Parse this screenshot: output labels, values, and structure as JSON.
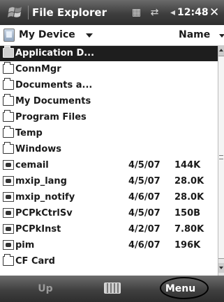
{
  "title_bar": {
    "app_title": "File Explorer",
    "clock": "12:48",
    "close": "✕",
    "status_icons": [
      "sync-icon",
      "connectivity-icon",
      "speaker-icon"
    ]
  },
  "address_bar": {
    "location": "My Device",
    "sort_by": "Name"
  },
  "files": [
    {
      "name": "Application D...",
      "type": "folder",
      "date": "",
      "size": "",
      "selected": true
    },
    {
      "name": "ConnMgr",
      "type": "folder",
      "date": "",
      "size": ""
    },
    {
      "name": "Documents a...",
      "type": "folder",
      "date": "",
      "size": ""
    },
    {
      "name": "My Documents",
      "type": "folder",
      "date": "",
      "size": ""
    },
    {
      "name": "Program Files",
      "type": "folder",
      "date": "",
      "size": ""
    },
    {
      "name": "Temp",
      "type": "folder",
      "date": "",
      "size": ""
    },
    {
      "name": "Windows",
      "type": "folder",
      "date": "",
      "size": ""
    },
    {
      "name": "cemail",
      "type": "file",
      "date": "4/5/07",
      "size": "144K"
    },
    {
      "name": "mxip_lang",
      "type": "file",
      "date": "4/5/07",
      "size": "28.0K"
    },
    {
      "name": "mxip_notify",
      "type": "file",
      "date": "4/6/07",
      "size": "28.0K"
    },
    {
      "name": "PCPkCtrlSv",
      "type": "file",
      "date": "4/5/07",
      "size": "150B"
    },
    {
      "name": "PCPkInst",
      "type": "file",
      "date": "4/2/07",
      "size": "7.80K"
    },
    {
      "name": "pim",
      "type": "file",
      "date": "4/6/07",
      "size": "196K"
    },
    {
      "name": "CF Card",
      "type": "folder",
      "date": "",
      "size": ""
    }
  ],
  "menu_bar": {
    "left_softkey": "Up",
    "right_softkey": "Menu",
    "center_icon": "keyboard-icon"
  },
  "colors": {
    "bar_dark": "#3e3e3e",
    "selection": "#1e1e1e",
    "disabled_softkey": "#9a9a9a"
  }
}
